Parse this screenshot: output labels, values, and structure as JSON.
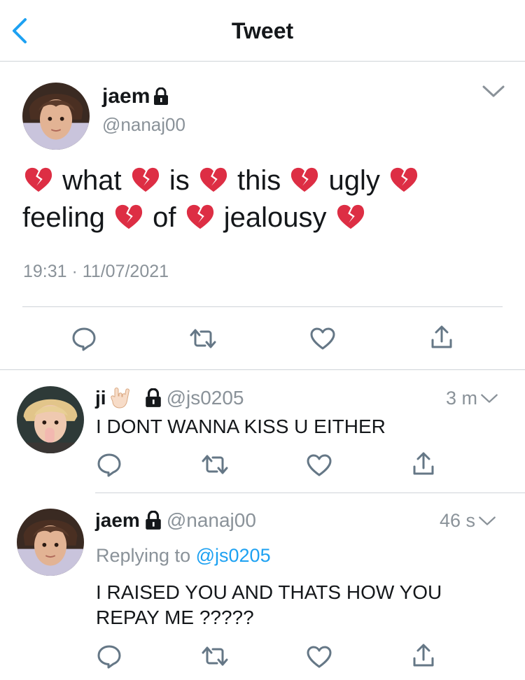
{
  "nav": {
    "title": "Tweet"
  },
  "main_tweet": {
    "author_name": "jaem",
    "author_handle": "@nanaj00",
    "words": [
      "what",
      "is",
      "this",
      "ugly",
      "feeling",
      "of",
      "jealousy"
    ],
    "timestamp": "19:31 · 11/07/2021",
    "emoji": "broken-heart-icon"
  },
  "replies": [
    {
      "author_name": "ji",
      "author_handle": "@js0205",
      "emoji": "love-you-gesture-icon",
      "time": "3 m",
      "text": "I DONT WANNA KISS U EITHER"
    },
    {
      "author_name": "jaem",
      "author_handle": "@nanaj00",
      "time": "46 s",
      "replying_prefix": "Replying to",
      "replying_to": "@js0205",
      "text_line1": "I RAISED YOU AND THATS HOW YOU",
      "text_line2": "REPAY ME ?????"
    }
  ],
  "colors": {
    "accent": "#1da1f2",
    "icon": "#657786",
    "muted": "#8a9299",
    "text": "#14171a",
    "divider": "#cfd4d8",
    "broken_heart": "#dd2e44"
  }
}
